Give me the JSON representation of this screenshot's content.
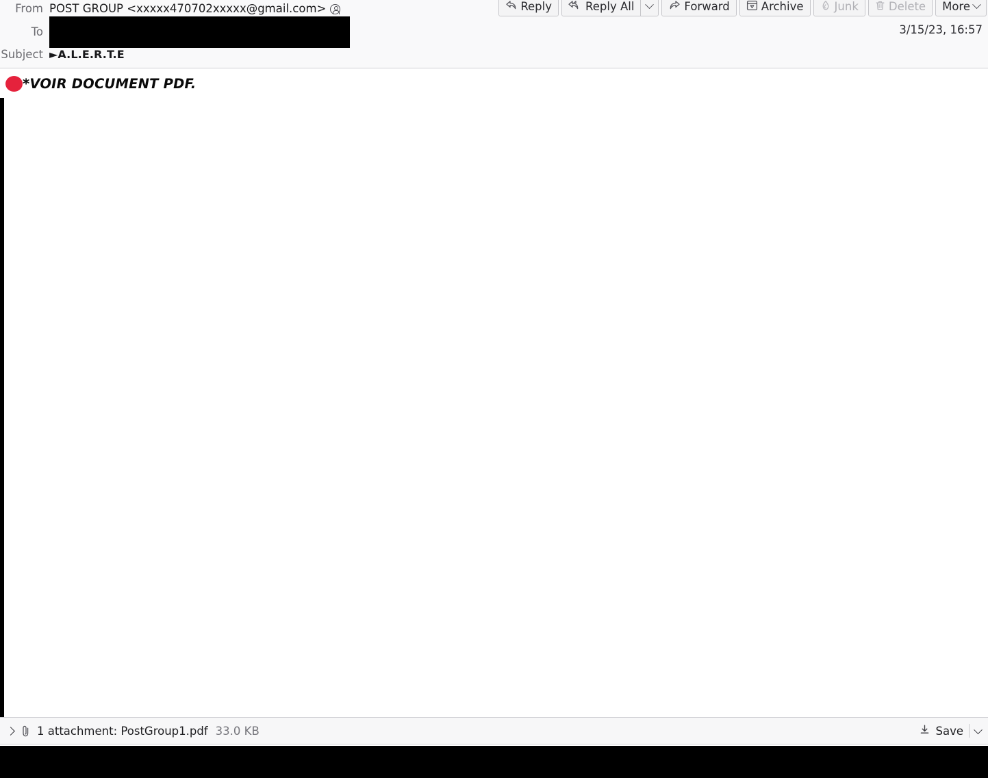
{
  "header": {
    "from": {
      "label": "From",
      "value": "POST GROUP <xxxxx470702xxxxx@gmail.com>",
      "contact_icon": "contact-avatar-icon"
    },
    "to": {
      "label": "To",
      "value": "",
      "redacted": true
    },
    "subject": {
      "label": "Subject",
      "value": "►A.L.E.R.T.E"
    },
    "date": "3/15/23, 16:57"
  },
  "toolbar": {
    "reply": {
      "label": "Reply",
      "icon": "reply-arrow-icon",
      "disabled": false
    },
    "reply_all": {
      "label": "Reply All",
      "icon": "reply-all-arrow-icon",
      "disabled": false
    },
    "reply_all_menu": {
      "icon": "chevron-down-icon"
    },
    "forward": {
      "label": "Forward",
      "icon": "forward-arrow-icon",
      "disabled": false
    },
    "archive": {
      "label": "Archive",
      "icon": "archive-box-icon",
      "disabled": false
    },
    "junk": {
      "label": "Junk",
      "icon": "junk-flame-icon",
      "disabled": true
    },
    "delete": {
      "label": "Delete",
      "icon": "trash-can-icon",
      "disabled": true
    },
    "more": {
      "label": "More",
      "icon": "chevron-down-icon",
      "disabled": false
    }
  },
  "body": {
    "marker_icon": "red-circle-emoji",
    "text": "*VOIR DOCUMENT PDF."
  },
  "attachment_bar": {
    "expander_icon": "chevron-right-icon",
    "clip_icon": "paperclip-icon",
    "summary": "1 attachment: PostGroup1.pdf",
    "size": "33.0 KB",
    "save": {
      "label": "Save",
      "icon": "download-icon"
    },
    "save_menu_icon": "chevron-down-icon"
  },
  "colors": {
    "accent_red": "#e5223c",
    "header_bg": "#f9f9fa",
    "toolbar_btn_bg": "#f4f4f5",
    "disabled_text": "#b0b0b5",
    "redaction": "#000000"
  }
}
